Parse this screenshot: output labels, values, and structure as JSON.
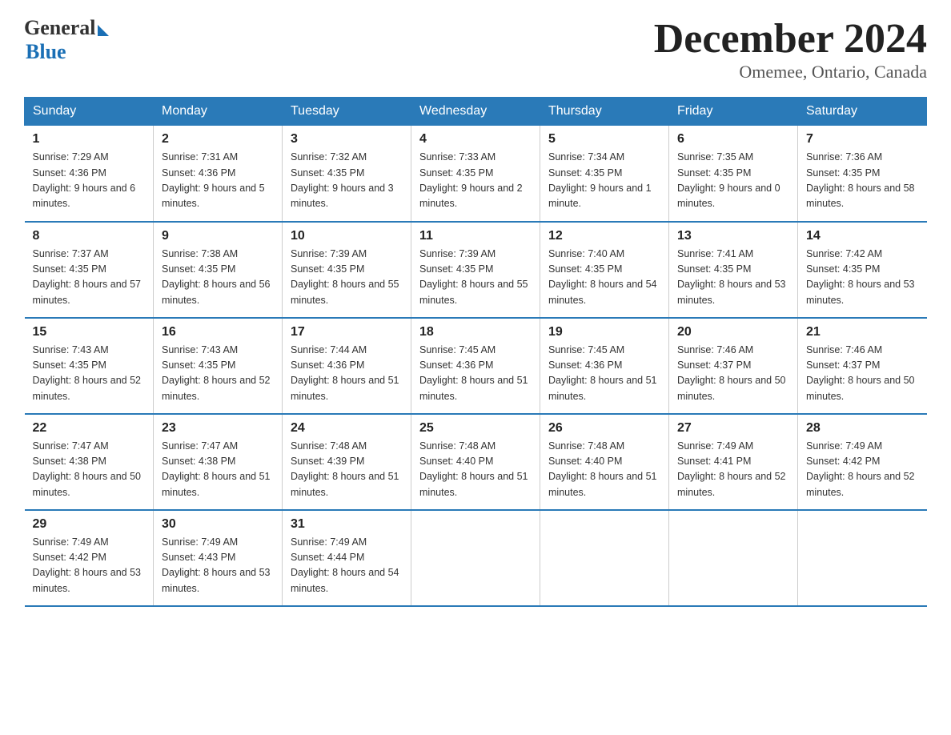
{
  "logo": {
    "general": "General",
    "blue": "Blue"
  },
  "title": "December 2024",
  "location": "Omemee, Ontario, Canada",
  "days_of_week": [
    "Sunday",
    "Monday",
    "Tuesday",
    "Wednesday",
    "Thursday",
    "Friday",
    "Saturday"
  ],
  "weeks": [
    [
      {
        "day": "1",
        "sunrise": "7:29 AM",
        "sunset": "4:36 PM",
        "daylight": "9 hours and 6 minutes."
      },
      {
        "day": "2",
        "sunrise": "7:31 AM",
        "sunset": "4:36 PM",
        "daylight": "9 hours and 5 minutes."
      },
      {
        "day": "3",
        "sunrise": "7:32 AM",
        "sunset": "4:35 PM",
        "daylight": "9 hours and 3 minutes."
      },
      {
        "day": "4",
        "sunrise": "7:33 AM",
        "sunset": "4:35 PM",
        "daylight": "9 hours and 2 minutes."
      },
      {
        "day": "5",
        "sunrise": "7:34 AM",
        "sunset": "4:35 PM",
        "daylight": "9 hours and 1 minute."
      },
      {
        "day": "6",
        "sunrise": "7:35 AM",
        "sunset": "4:35 PM",
        "daylight": "9 hours and 0 minutes."
      },
      {
        "day": "7",
        "sunrise": "7:36 AM",
        "sunset": "4:35 PM",
        "daylight": "8 hours and 58 minutes."
      }
    ],
    [
      {
        "day": "8",
        "sunrise": "7:37 AM",
        "sunset": "4:35 PM",
        "daylight": "8 hours and 57 minutes."
      },
      {
        "day": "9",
        "sunrise": "7:38 AM",
        "sunset": "4:35 PM",
        "daylight": "8 hours and 56 minutes."
      },
      {
        "day": "10",
        "sunrise": "7:39 AM",
        "sunset": "4:35 PM",
        "daylight": "8 hours and 55 minutes."
      },
      {
        "day": "11",
        "sunrise": "7:39 AM",
        "sunset": "4:35 PM",
        "daylight": "8 hours and 55 minutes."
      },
      {
        "day": "12",
        "sunrise": "7:40 AM",
        "sunset": "4:35 PM",
        "daylight": "8 hours and 54 minutes."
      },
      {
        "day": "13",
        "sunrise": "7:41 AM",
        "sunset": "4:35 PM",
        "daylight": "8 hours and 53 minutes."
      },
      {
        "day": "14",
        "sunrise": "7:42 AM",
        "sunset": "4:35 PM",
        "daylight": "8 hours and 53 minutes."
      }
    ],
    [
      {
        "day": "15",
        "sunrise": "7:43 AM",
        "sunset": "4:35 PM",
        "daylight": "8 hours and 52 minutes."
      },
      {
        "day": "16",
        "sunrise": "7:43 AM",
        "sunset": "4:35 PM",
        "daylight": "8 hours and 52 minutes."
      },
      {
        "day": "17",
        "sunrise": "7:44 AM",
        "sunset": "4:36 PM",
        "daylight": "8 hours and 51 minutes."
      },
      {
        "day": "18",
        "sunrise": "7:45 AM",
        "sunset": "4:36 PM",
        "daylight": "8 hours and 51 minutes."
      },
      {
        "day": "19",
        "sunrise": "7:45 AM",
        "sunset": "4:36 PM",
        "daylight": "8 hours and 51 minutes."
      },
      {
        "day": "20",
        "sunrise": "7:46 AM",
        "sunset": "4:37 PM",
        "daylight": "8 hours and 50 minutes."
      },
      {
        "day": "21",
        "sunrise": "7:46 AM",
        "sunset": "4:37 PM",
        "daylight": "8 hours and 50 minutes."
      }
    ],
    [
      {
        "day": "22",
        "sunrise": "7:47 AM",
        "sunset": "4:38 PM",
        "daylight": "8 hours and 50 minutes."
      },
      {
        "day": "23",
        "sunrise": "7:47 AM",
        "sunset": "4:38 PM",
        "daylight": "8 hours and 51 minutes."
      },
      {
        "day": "24",
        "sunrise": "7:48 AM",
        "sunset": "4:39 PM",
        "daylight": "8 hours and 51 minutes."
      },
      {
        "day": "25",
        "sunrise": "7:48 AM",
        "sunset": "4:40 PM",
        "daylight": "8 hours and 51 minutes."
      },
      {
        "day": "26",
        "sunrise": "7:48 AM",
        "sunset": "4:40 PM",
        "daylight": "8 hours and 51 minutes."
      },
      {
        "day": "27",
        "sunrise": "7:49 AM",
        "sunset": "4:41 PM",
        "daylight": "8 hours and 52 minutes."
      },
      {
        "day": "28",
        "sunrise": "7:49 AM",
        "sunset": "4:42 PM",
        "daylight": "8 hours and 52 minutes."
      }
    ],
    [
      {
        "day": "29",
        "sunrise": "7:49 AM",
        "sunset": "4:42 PM",
        "daylight": "8 hours and 53 minutes."
      },
      {
        "day": "30",
        "sunrise": "7:49 AM",
        "sunset": "4:43 PM",
        "daylight": "8 hours and 53 minutes."
      },
      {
        "day": "31",
        "sunrise": "7:49 AM",
        "sunset": "4:44 PM",
        "daylight": "8 hours and 54 minutes."
      },
      null,
      null,
      null,
      null
    ]
  ],
  "labels": {
    "sunrise": "Sunrise:",
    "sunset": "Sunset:",
    "daylight": "Daylight:"
  }
}
